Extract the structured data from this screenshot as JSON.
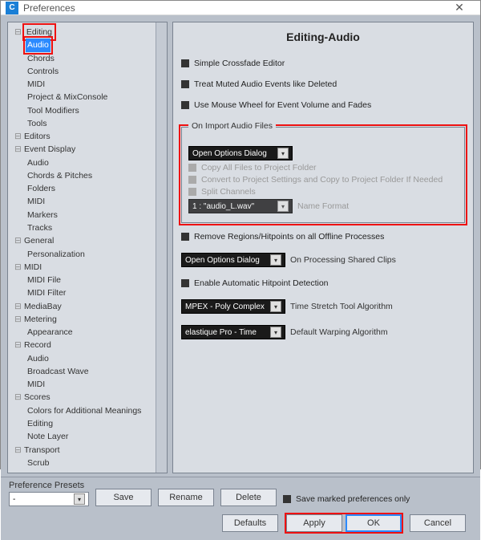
{
  "window": {
    "title": "Preferences"
  },
  "tree": {
    "Editing": {
      "label": "Editing",
      "children": {
        "Audio": "Audio",
        "Chords": "Chords",
        "Controls": "Controls",
        "MIDI": "MIDI",
        "ProjectMix": "Project & MixConsole",
        "ToolModifiers": "Tool Modifiers",
        "Tools": "Tools"
      }
    },
    "Editors": "Editors",
    "EventDisplay": {
      "label": "Event Display",
      "children": {
        "Audio": "Audio",
        "ChordsPitches": "Chords & Pitches",
        "Folders": "Folders",
        "MIDI": "MIDI",
        "Markers": "Markers",
        "Tracks": "Tracks"
      }
    },
    "General": {
      "label": "General",
      "children": {
        "Personalization": "Personalization"
      }
    },
    "MIDI": {
      "label": "MIDI",
      "children": {
        "MIDIFile": "MIDI File",
        "MIDIFilter": "MIDI Filter"
      }
    },
    "MediaBay": "MediaBay",
    "Metering": {
      "label": "Metering",
      "children": {
        "Appearance": "Appearance"
      }
    },
    "Record": {
      "label": "Record",
      "children": {
        "Audio": "Audio",
        "BroadcastWave": "Broadcast Wave",
        "MIDI": "MIDI"
      }
    },
    "Scores": {
      "label": "Scores",
      "children": {
        "Colors": "Colors for Additional Meanings",
        "Editing": "Editing",
        "NoteLayer": "Note Layer"
      }
    },
    "Transport": {
      "label": "Transport",
      "children": {
        "Scrub": "Scrub"
      }
    }
  },
  "page": {
    "heading": "Editing-Audio",
    "simpleCrossfade": "Simple Crossfade Editor",
    "treatMuted": "Treat Muted Audio Events like Deleted",
    "useMouseWheel": "Use Mouse Wheel for Event Volume and Fades",
    "importGroup": "On Import Audio Files",
    "importDropdown": "Open Options Dialog",
    "copyAll": "Copy All Files to Project Folder",
    "convert": "Convert to Project Settings and Copy to Project Folder If Needed",
    "splitChannels": "Split Channels",
    "nameFormatValue": "1 : \"audio_L.wav\"",
    "nameFormat": "Name Format",
    "removeRegions": "Remove Regions/Hitpoints on all Offline Processes",
    "onProcessingDrop": "Open Options Dialog",
    "onProcessing": "On Processing Shared Clips",
    "enableHitpoint": "Enable Automatic Hitpoint Detection",
    "timeStretchDrop": "MPEX - Poly Complex",
    "timeStretch": "Time Stretch Tool Algorithm",
    "warpingDrop": "elastique Pro - Time",
    "warping": "Default Warping Algorithm"
  },
  "presets": {
    "label": "Preference Presets",
    "value": "-",
    "save": "Save",
    "rename": "Rename",
    "delete": "Delete",
    "saveMarked": "Save marked preferences only"
  },
  "footer": {
    "defaults": "Defaults",
    "apply": "Apply",
    "ok": "OK",
    "cancel": "Cancel"
  }
}
